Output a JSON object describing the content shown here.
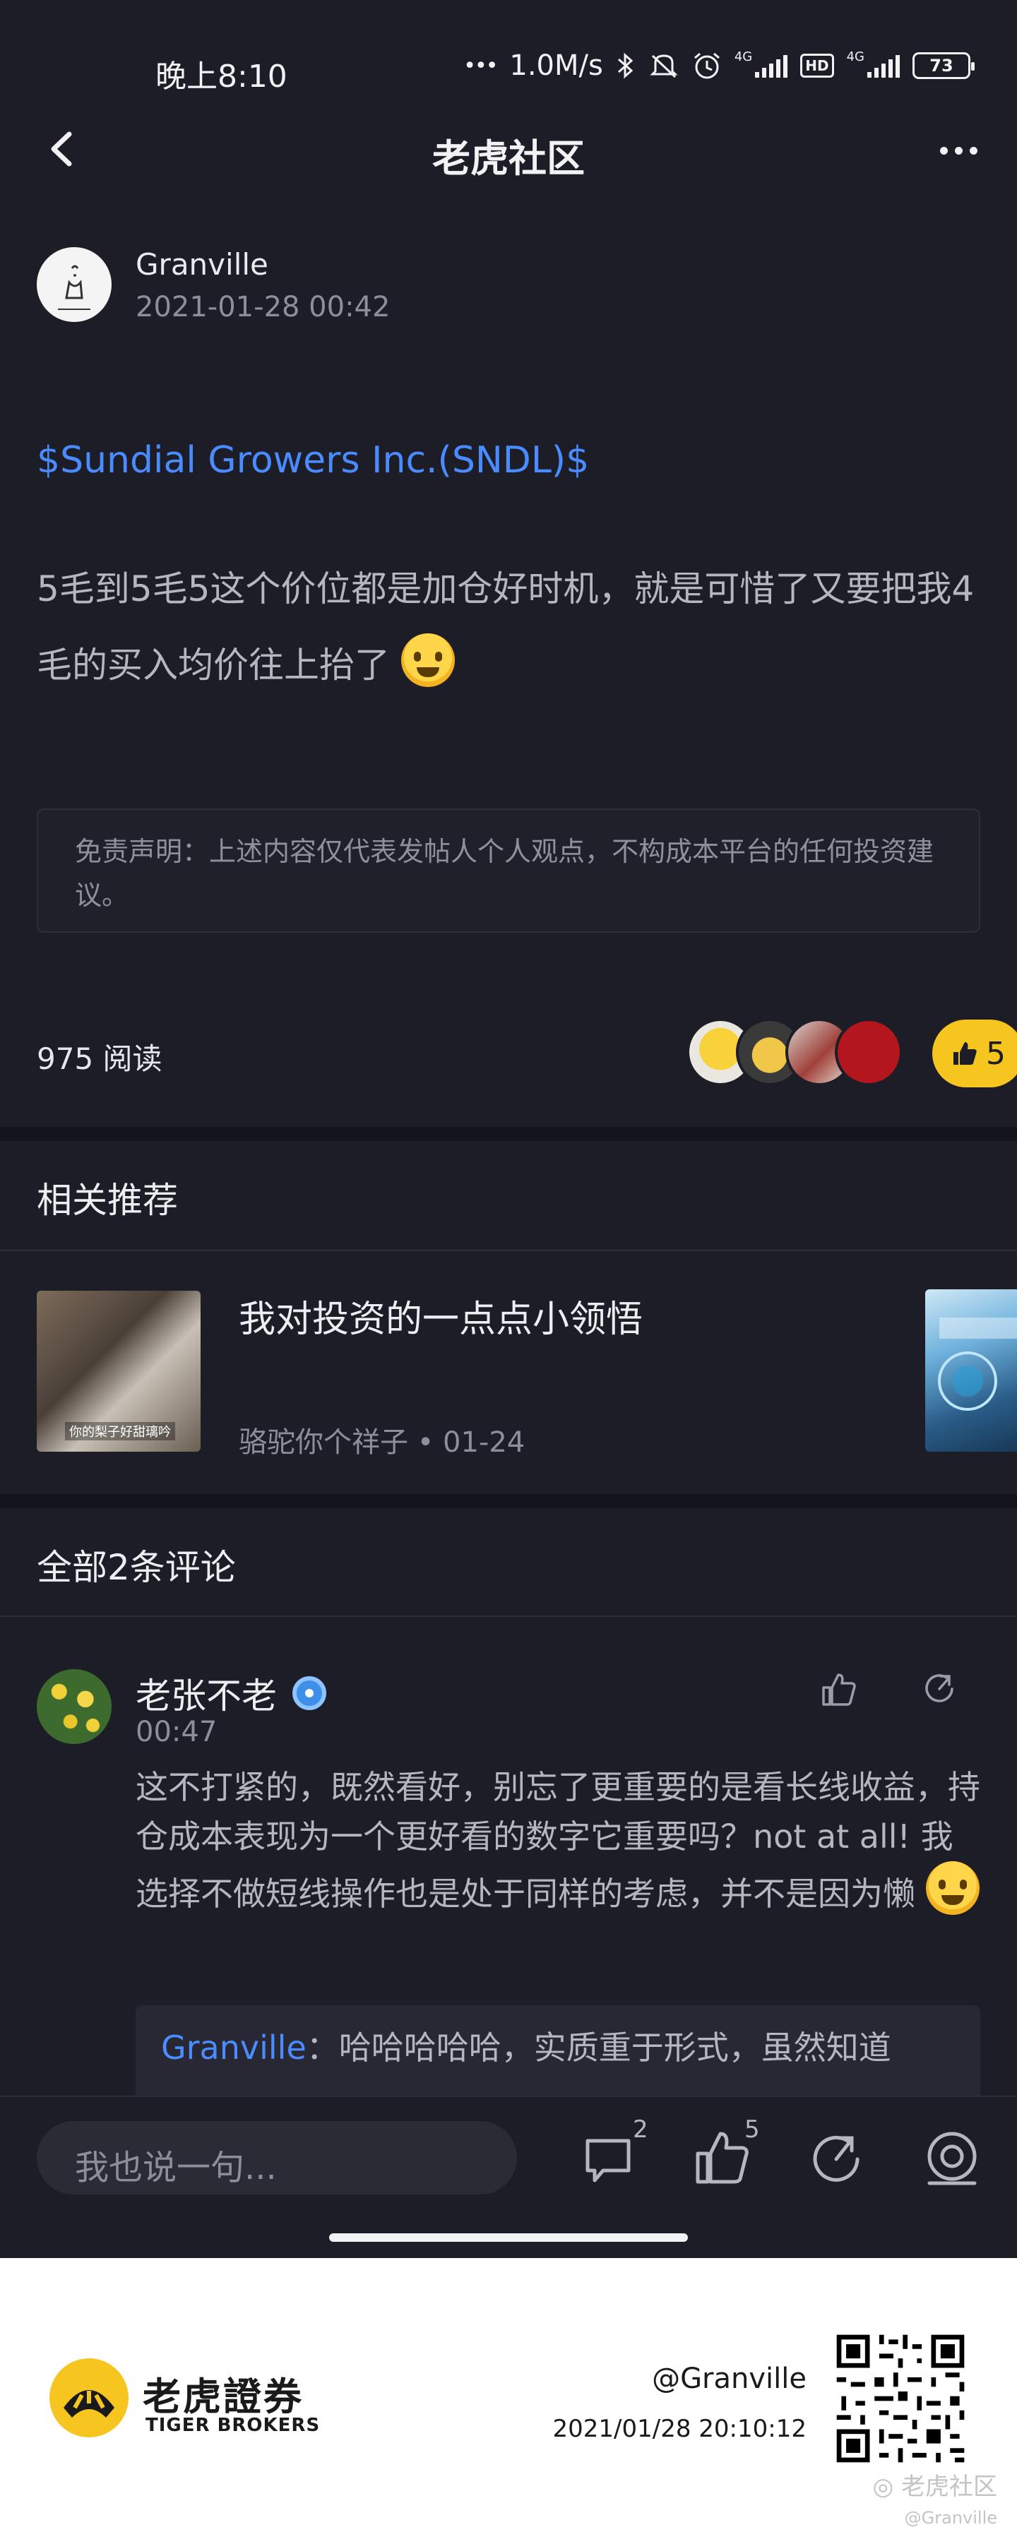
{
  "status_bar": {
    "time": "晚上8:10",
    "speed": "1.0M/s",
    "net1": "4G",
    "net2": "4G",
    "hd": "HD",
    "battery": "73"
  },
  "nav": {
    "title": "老虎社区"
  },
  "post": {
    "author": "Granville",
    "time": "2021-01-28 00:42",
    "stock_link": "$Sundial Growers Inc.(SNDL)$",
    "body": "5毛到5毛5这个价位都是加仓好时机，就是可惜了又要把我4毛的买入均价往上抬了",
    "disclaimer": "免责声明：上述内容仅代表发帖人个人观点，不构成本平台的任何投资建议。",
    "read_count": "975 阅读",
    "like_count": "5"
  },
  "related": {
    "title": "相关推荐",
    "item_title": "我对投资的一点点小领悟",
    "item_meta": "骆驼你个祥子 • 01-24",
    "thumb_caption": "你的梨子好甜璃吟"
  },
  "comments": {
    "title": "全部2条评论",
    "items": [
      {
        "name": "老张不老",
        "time": "00:47",
        "body": "这不打紧的，既然看好，别忘了更重要的是看长线收益，持仓成本表现为一个更好看的数字它重要吗？not at all! 我选择不做短线操作也是处于同样的考虑，并不是因为懒",
        "reply_name": "Granville",
        "reply_body": "：哈哈哈哈哈，实质重于形式，虽然知道"
      }
    ]
  },
  "bottom_bar": {
    "input_placeholder": "我也说一句...",
    "comment_count": "2",
    "like_count": "5"
  },
  "footer": {
    "brand_cn": "老虎證券",
    "brand_en": "TIGER BROKERS",
    "user": "@Granville",
    "timestamp": "2021/01/28 20:10:12",
    "watermark": "老虎社区",
    "watermark_sub": "@Granville"
  },
  "colors": {
    "background": "#1c1d26",
    "link": "#4a8cff",
    "accent_yellow": "#f7c520"
  }
}
